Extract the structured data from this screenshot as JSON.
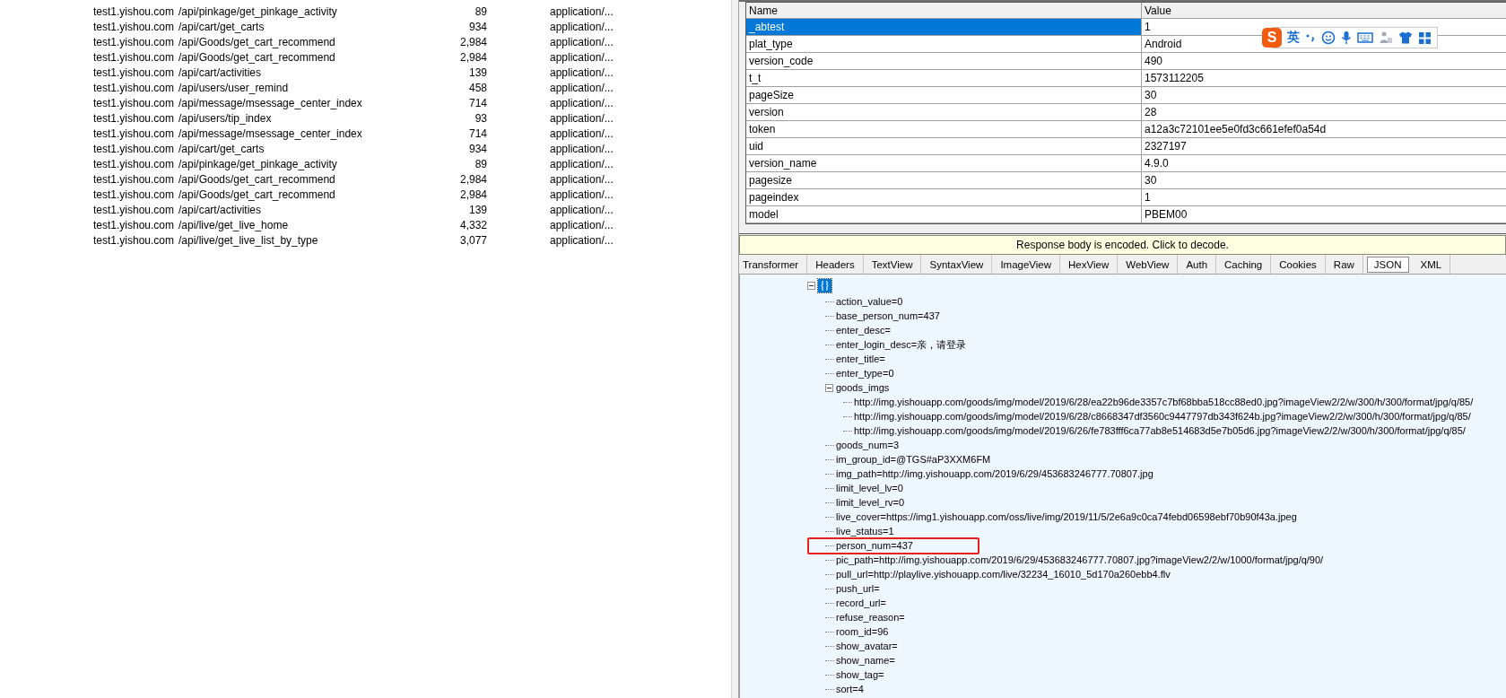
{
  "sessions": [
    {
      "host": "test1.yishou.com",
      "url": "/api/pinkage/get_pinkage_activity",
      "size": "89",
      "content_type": "application/..."
    },
    {
      "host": "test1.yishou.com",
      "url": "/api/cart/get_carts",
      "size": "934",
      "content_type": "application/..."
    },
    {
      "host": "test1.yishou.com",
      "url": "/api/Goods/get_cart_recommend",
      "size": "2,984",
      "content_type": "application/..."
    },
    {
      "host": "test1.yishou.com",
      "url": "/api/Goods/get_cart_recommend",
      "size": "2,984",
      "content_type": "application/..."
    },
    {
      "host": "test1.yishou.com",
      "url": "/api/cart/activities",
      "size": "139",
      "content_type": "application/..."
    },
    {
      "host": "test1.yishou.com",
      "url": "/api/users/user_remind",
      "size": "458",
      "content_type": "application/..."
    },
    {
      "host": "test1.yishou.com",
      "url": "/api/message/msessage_center_index",
      "size": "714",
      "content_type": "application/..."
    },
    {
      "host": "test1.yishou.com",
      "url": "/api/users/tip_index",
      "size": "93",
      "content_type": "application/..."
    },
    {
      "host": "test1.yishou.com",
      "url": "/api/message/msessage_center_index",
      "size": "714",
      "content_type": "application/..."
    },
    {
      "host": "test1.yishou.com",
      "url": "/api/cart/get_carts",
      "size": "934",
      "content_type": "application/..."
    },
    {
      "host": "test1.yishou.com",
      "url": "/api/pinkage/get_pinkage_activity",
      "size": "89",
      "content_type": "application/..."
    },
    {
      "host": "test1.yishou.com",
      "url": "/api/Goods/get_cart_recommend",
      "size": "2,984",
      "content_type": "application/..."
    },
    {
      "host": "test1.yishou.com",
      "url": "/api/Goods/get_cart_recommend",
      "size": "2,984",
      "content_type": "application/..."
    },
    {
      "host": "test1.yishou.com",
      "url": "/api/cart/activities",
      "size": "139",
      "content_type": "application/..."
    },
    {
      "host": "test1.yishou.com",
      "url": "/api/live/get_live_home",
      "size": "4,332",
      "content_type": "application/..."
    },
    {
      "host": "test1.yishou.com",
      "url": "/api/live/get_live_list_by_type",
      "size": "3,077",
      "content_type": "application/..."
    }
  ],
  "request_body": {
    "columns": [
      "Name",
      "Value"
    ],
    "rows": [
      {
        "name": "_abtest",
        "value": "1",
        "selected": true
      },
      {
        "name": "plat_type",
        "value": "Android",
        "selected": false
      },
      {
        "name": "version_code",
        "value": "490",
        "selected": false
      },
      {
        "name": "t_t",
        "value": "1573112205",
        "selected": false
      },
      {
        "name": "pageSize",
        "value": "30",
        "selected": false
      },
      {
        "name": "version",
        "value": "28",
        "selected": false
      },
      {
        "name": "token",
        "value": "a12a3c72101ee5e0fd3c661efef0a54d",
        "selected": false
      },
      {
        "name": "uid",
        "value": "2327197",
        "selected": false
      },
      {
        "name": "version_name",
        "value": "4.9.0",
        "selected": false
      },
      {
        "name": "pagesize",
        "value": "30",
        "selected": false
      },
      {
        "name": "pageindex",
        "value": "1",
        "selected": false
      },
      {
        "name": "model",
        "value": "PBEM00",
        "selected": false
      }
    ]
  },
  "ime_toolbar": {
    "logo": "S",
    "mode": "英"
  },
  "notice": "Response body is encoded. Click to decode.",
  "tabs": [
    {
      "label": "Transformer",
      "selected": false
    },
    {
      "label": "Headers",
      "selected": false
    },
    {
      "label": "TextView",
      "selected": false
    },
    {
      "label": "SyntaxView",
      "selected": false
    },
    {
      "label": "ImageView",
      "selected": false
    },
    {
      "label": "HexView",
      "selected": false
    },
    {
      "label": "WebView",
      "selected": false
    },
    {
      "label": "Auth",
      "selected": false
    },
    {
      "label": "Caching",
      "selected": false
    },
    {
      "label": "Cookies",
      "selected": false
    },
    {
      "label": "Raw",
      "selected": false
    },
    {
      "label": "JSON",
      "selected": true
    },
    {
      "label": "XML",
      "selected": false
    }
  ],
  "tree": {
    "root": {
      "expanded": true,
      "selected": true,
      "children": [
        {
          "label": "action_value=0",
          "highlighted": false
        },
        {
          "label": "base_person_num=437",
          "highlighted": false
        },
        {
          "label": "enter_desc=",
          "highlighted": false
        },
        {
          "label": "enter_login_desc=亲，请登录",
          "highlighted": false
        },
        {
          "label": "enter_title=",
          "highlighted": false
        },
        {
          "label": "enter_type=0",
          "highlighted": false
        },
        {
          "label": "goods_imgs",
          "highlighted": false,
          "expanded": true,
          "children": [
            {
              "label": "http://img.yishouapp.com/goods/img/model/2019/6/28/ea22b96de3357c7bf68bba518cc88ed0.jpg?imageView2/2/w/300/h/300/format/jpg/q/85/",
              "highlighted": false
            },
            {
              "label": "http://img.yishouapp.com/goods/img/model/2019/6/28/c8668347df3560c9447797db343f624b.jpg?imageView2/2/w/300/h/300/format/jpg/q/85/",
              "highlighted": false
            },
            {
              "label": "http://img.yishouapp.com/goods/img/model/2019/6/26/fe783fff6ca77ab8e514683d5e7b05d6.jpg?imageView2/2/w/300/h/300/format/jpg/q/85/",
              "highlighted": false
            }
          ]
        },
        {
          "label": "goods_num=3",
          "highlighted": false
        },
        {
          "label": "im_group_id=@TGS#aP3XXM6FM",
          "highlighted": false
        },
        {
          "label": "img_path=http://img.yishouapp.com/2019/6/29/453683246777.70807.jpg",
          "highlighted": false
        },
        {
          "label": "limit_level_lv=0",
          "highlighted": false
        },
        {
          "label": "limit_level_rv=0",
          "highlighted": false
        },
        {
          "label": "live_cover=https://img1.yishouapp.com/oss/live/img/2019/11/5/2e6a9c0ca74febd06598ebf70b90f43a.jpeg",
          "highlighted": false
        },
        {
          "label": "live_status=1",
          "highlighted": false
        },
        {
          "label": "person_num=437",
          "highlighted": true
        },
        {
          "label": "pic_path=http://img.yishouapp.com/2019/6/29/453683246777.70807.jpg?imageView2/2/w/1000/format/jpg/q/90/",
          "highlighted": false
        },
        {
          "label": "pull_url=http://playlive.yishouapp.com/live/32234_16010_5d170a260ebb4.flv",
          "highlighted": false
        },
        {
          "label": "push_url=",
          "highlighted": false
        },
        {
          "label": "record_url=",
          "highlighted": false
        },
        {
          "label": "refuse_reason=",
          "highlighted": false
        },
        {
          "label": "room_id=96",
          "highlighted": false
        },
        {
          "label": "show_avatar=",
          "highlighted": false
        },
        {
          "label": "show_name=",
          "highlighted": false
        },
        {
          "label": "show_tag=",
          "highlighted": false
        },
        {
          "label": "sort=4",
          "highlighted": false
        }
      ]
    }
  }
}
